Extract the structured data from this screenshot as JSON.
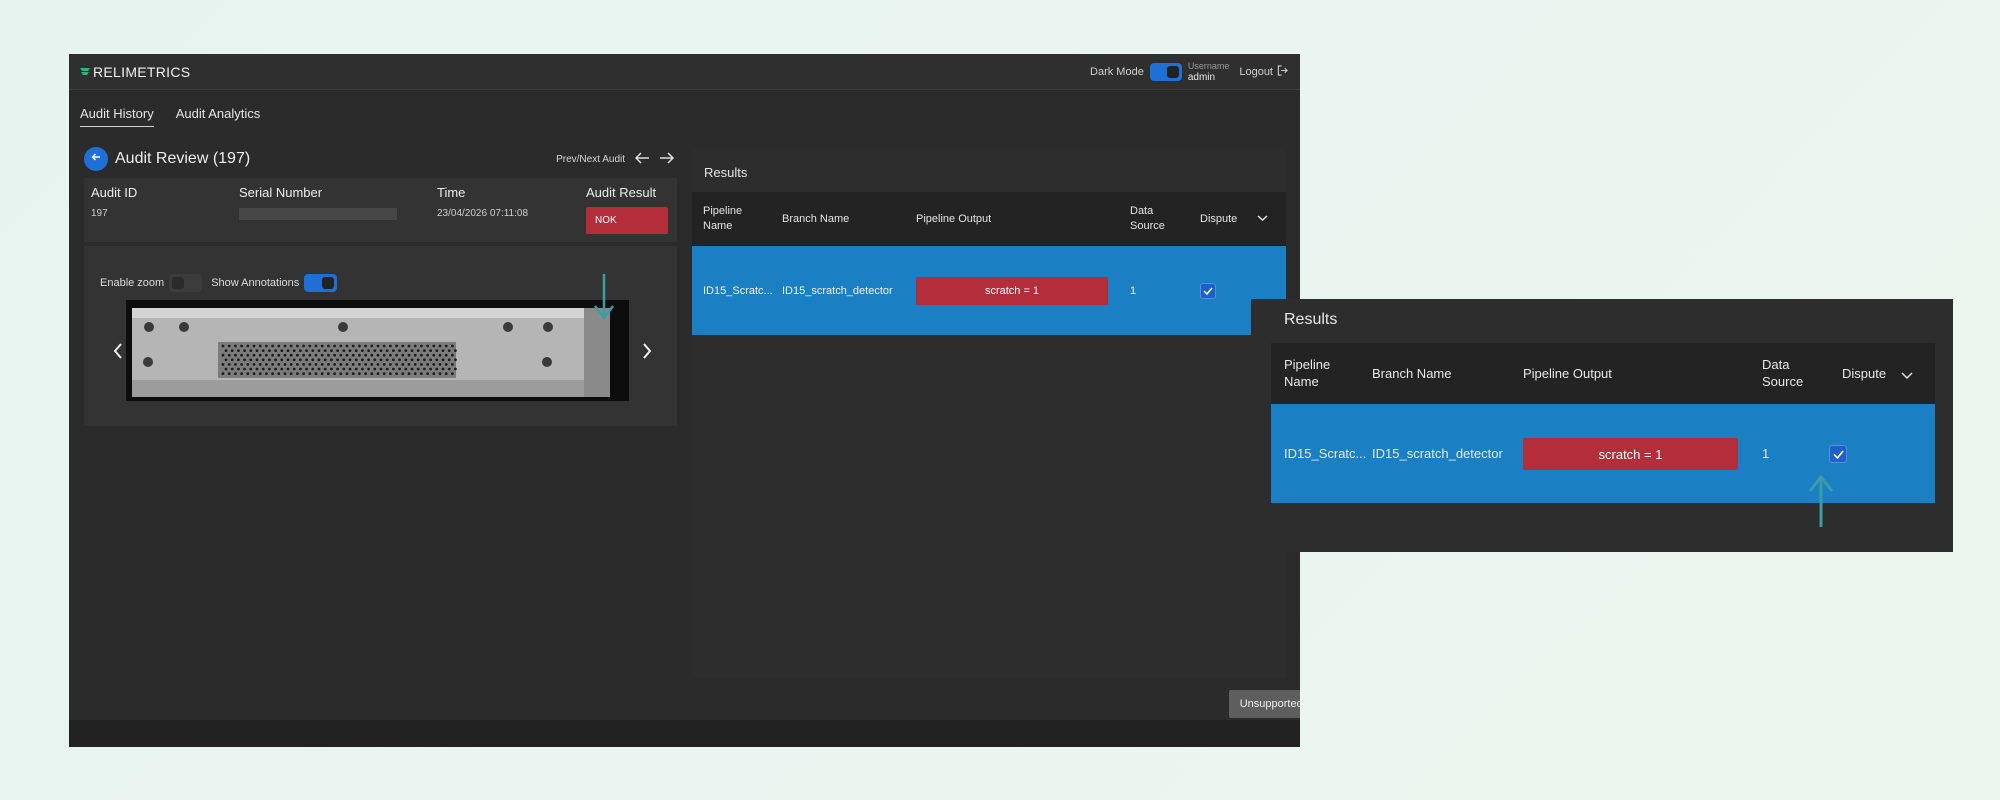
{
  "app": {
    "logo_text": "RELIMETRICS",
    "dark_mode_label": "Dark Mode",
    "username_label": "Username",
    "username_value": "admin",
    "logout_label": "Logout"
  },
  "tabs": [
    {
      "label": "Audit History",
      "active": true
    },
    {
      "label": "Audit Analytics",
      "active": false
    }
  ],
  "review": {
    "title": "Audit Review (197)",
    "prevnext_label": "Prev/Next Audit",
    "headers": {
      "audit_id": "Audit ID",
      "serial_number": "Serial Number",
      "time": "Time",
      "audit_result": "Audit Result"
    },
    "audit_id": "197",
    "serial_number": "",
    "time": "23/04/2026 07:11:08",
    "audit_result": "NOK",
    "enable_zoom_label": "Enable zoom",
    "enable_zoom_on": false,
    "show_annotations_label": "Show Annotations",
    "show_annotations_on": true
  },
  "results": {
    "title": "Results",
    "columns": {
      "pipeline_name": "Pipeline Name",
      "branch_name": "Branch Name",
      "pipeline_output": "Pipeline Output",
      "data_source": "Data Source",
      "dispute": "Dispute"
    },
    "rows": [
      {
        "pipeline_name": "ID15_Scratc...",
        "branch_name": "ID15_scratch_detector",
        "pipeline_output": "scratch = 1",
        "data_source": "1",
        "dispute": true
      }
    ],
    "unsupported_label": "Unsupported Outputs"
  },
  "colors": {
    "accent_blue": "#1e6fd6",
    "row_highlight": "#1b7fc4",
    "nok_red": "#b32d3a",
    "annotation_teal": "#3a9ca4"
  },
  "icons": [
    "logo-icon",
    "logout-icon",
    "back-arrow-icon",
    "arrow-left-icon",
    "arrow-right-icon",
    "chevron-down-icon",
    "check-icon",
    "carousel-prev-icon",
    "carousel-next-icon",
    "annotation-arrow-icon"
  ]
}
